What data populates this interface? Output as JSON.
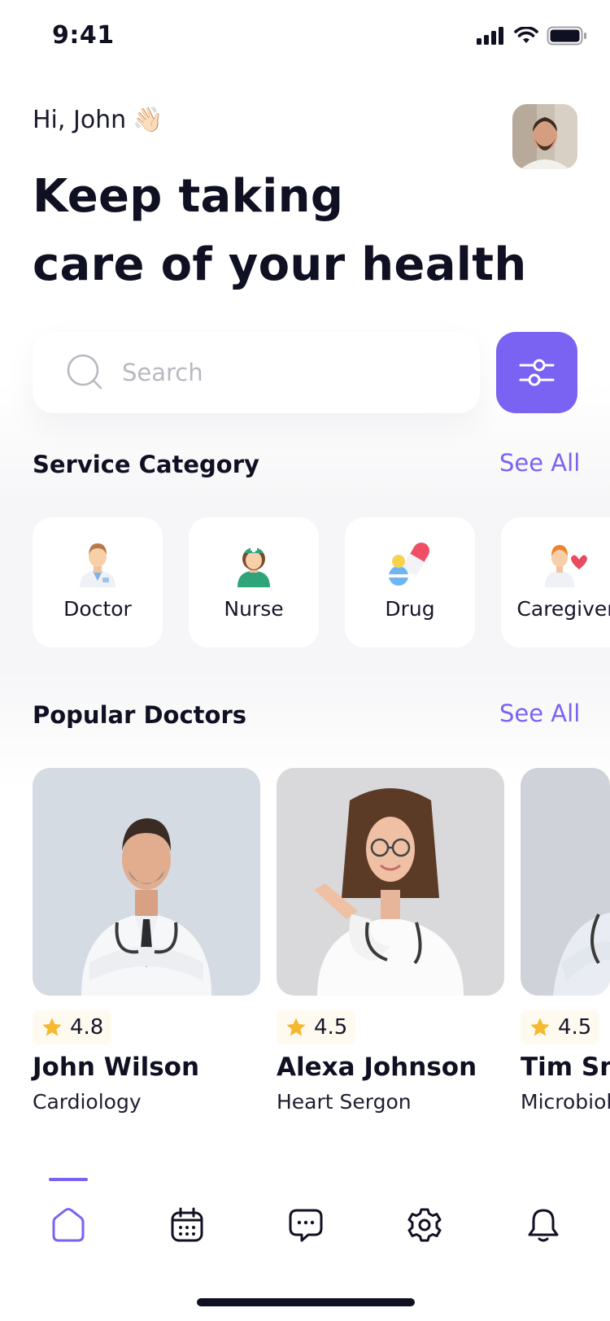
{
  "status_bar": {
    "time": "9:41",
    "icons": [
      "signal-icon",
      "wifi-icon",
      "battery-icon"
    ]
  },
  "header": {
    "greeting": "Hi, John",
    "greeting_emoji": "👋🏻",
    "headline_line1": "Keep taking",
    "headline_line2": "care of your health",
    "avatar": "user-avatar"
  },
  "search": {
    "placeholder": "Search",
    "value": "",
    "icon": "search-icon",
    "filter_icon": "filter-sliders-icon"
  },
  "service_category": {
    "title": "Service Category",
    "see_all": "See All",
    "items": [
      {
        "label": "Doctor",
        "icon": "doctor-icon"
      },
      {
        "label": "Nurse",
        "icon": "nurse-icon"
      },
      {
        "label": "Drug",
        "icon": "pill-icon"
      },
      {
        "label": "Caregiver",
        "icon": "caregiver-icon"
      }
    ]
  },
  "popular_doctors": {
    "title": "Popular Doctors",
    "see_all": "See All",
    "items": [
      {
        "name": "John Wilson",
        "specialty": "Cardiology",
        "rating": "4.8"
      },
      {
        "name": "Alexa Johnson",
        "specialty": "Heart Sergon",
        "rating": "4.5"
      },
      {
        "name": "Tim Smith",
        "specialty": "Microbiology",
        "rating": "4.5"
      }
    ]
  },
  "tab_bar": {
    "items": [
      {
        "icon": "home-icon",
        "active": true
      },
      {
        "icon": "calendar-icon",
        "active": false
      },
      {
        "icon": "chat-icon",
        "active": false
      },
      {
        "icon": "settings-icon",
        "active": false
      },
      {
        "icon": "bell-icon",
        "active": false
      }
    ]
  },
  "colors": {
    "accent": "#7a63f3",
    "text_dark": "#101023",
    "star": "#f5b82e",
    "placeholder": "#b8b8c2"
  }
}
